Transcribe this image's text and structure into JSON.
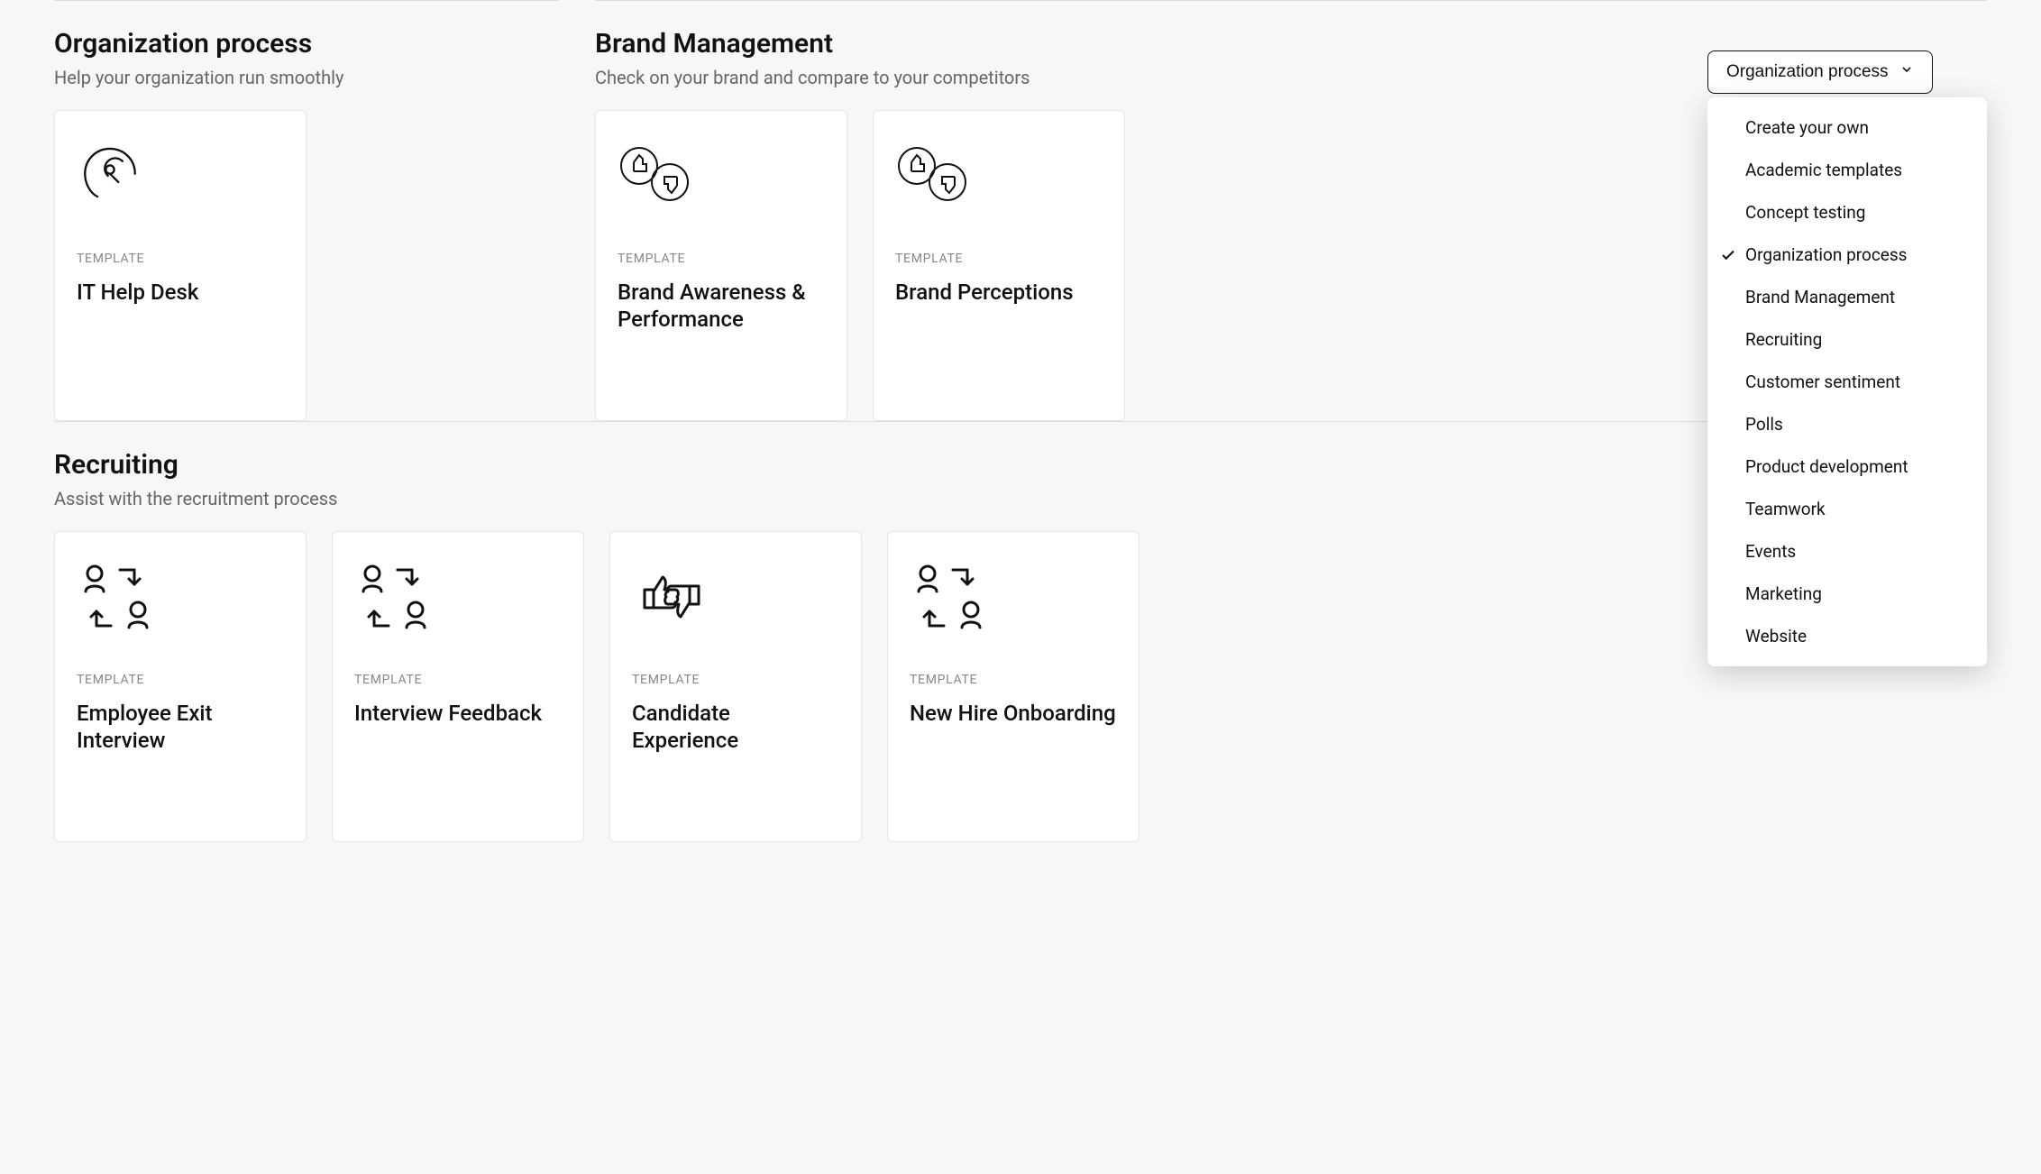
{
  "template_label": "TEMPLATE",
  "dropdown": {
    "selected": "Organization process",
    "items": [
      {
        "label": "Create your own",
        "selected": false
      },
      {
        "label": "Academic templates",
        "selected": false
      },
      {
        "label": "Concept testing",
        "selected": false
      },
      {
        "label": "Organization process",
        "selected": true
      },
      {
        "label": "Brand Management",
        "selected": false
      },
      {
        "label": "Recruiting",
        "selected": false
      },
      {
        "label": "Customer sentiment",
        "selected": false
      },
      {
        "label": "Polls",
        "selected": false
      },
      {
        "label": "Product development",
        "selected": false
      },
      {
        "label": "Teamwork",
        "selected": false
      },
      {
        "label": "Events",
        "selected": false
      },
      {
        "label": "Marketing",
        "selected": false
      },
      {
        "label": "Website",
        "selected": false
      }
    ]
  },
  "sections": {
    "org": {
      "title": "Organization process",
      "subtitle": "Help your organization run smoothly",
      "cards": [
        {
          "title": "IT Help Desk",
          "icon": "headset"
        }
      ]
    },
    "brand": {
      "title": "Brand Management",
      "subtitle": "Check on your brand and compare to your competitors",
      "cards": [
        {
          "title": "Brand Awareness & Performance",
          "icon": "thumbs-up-down"
        },
        {
          "title": "Brand Perceptions",
          "icon": "thumbs-up-down"
        }
      ]
    },
    "recruiting": {
      "title": "Recruiting",
      "subtitle": "Assist with the recruitment process",
      "cards": [
        {
          "title": "Employee Exit Interview",
          "icon": "people-swap"
        },
        {
          "title": "Interview Feedback",
          "icon": "people-swap"
        },
        {
          "title": "Candidate Experience",
          "icon": "thumbs-pair"
        },
        {
          "title": "New Hire Onboarding",
          "icon": "people-swap"
        }
      ]
    }
  }
}
